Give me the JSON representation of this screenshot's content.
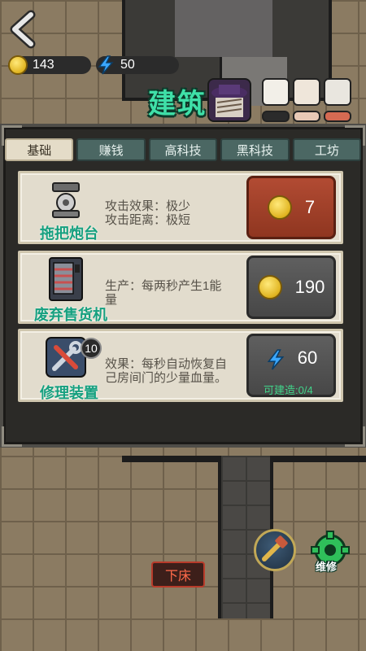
{
  "resources": {
    "coins": "143",
    "energy": "50"
  },
  "title": "建筑",
  "tabs": [
    {
      "label": "基础",
      "active": true
    },
    {
      "label": "赚钱",
      "active": false
    },
    {
      "label": "高科技",
      "active": false
    },
    {
      "label": "黑科技",
      "active": false
    },
    {
      "label": "工坊",
      "active": false
    }
  ],
  "buildings": [
    {
      "name": "拖把炮台",
      "desc_line1": "攻击效果：极少",
      "desc_line2": "攻击距离：极短",
      "cost": "7",
      "currency": "coin-icon",
      "button_color": "#a8432c"
    },
    {
      "name": "废弃售货机",
      "desc_line1": "生产：每两秒产生1能",
      "desc_line2": "量",
      "cost": "190",
      "currency": "coin-icon",
      "button_color": "#555555"
    },
    {
      "name": "修理装置",
      "level": "10",
      "desc_line1": "效果：每秒自动恢复自",
      "desc_line2": "己房间门的少量血量。",
      "cost": "60",
      "currency": "energy-icon",
      "buildable": "可建造:0/4",
      "button_color": "#555555"
    }
  ],
  "bottom": {
    "bed_label": "下床",
    "repair_label": "维修"
  },
  "colors": {
    "title": "#3fe0a8",
    "active_tab": "#e4dcc8",
    "tab": "#4b6763",
    "buildable": "#41d38a"
  }
}
